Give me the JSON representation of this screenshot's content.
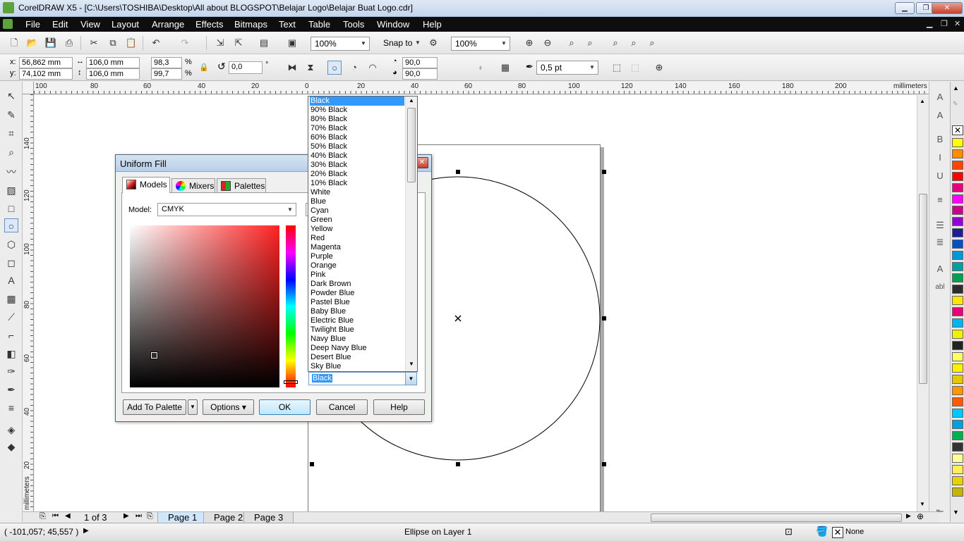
{
  "window": {
    "title": "CorelDRAW X5 - [C:\\Users\\TOSHIBA\\Desktop\\All about BLOGSPOT\\Belajar Logo\\Belajar Buat Logo.cdr]"
  },
  "menu": [
    "File",
    "Edit",
    "View",
    "Layout",
    "Arrange",
    "Effects",
    "Bitmaps",
    "Text",
    "Table",
    "Tools",
    "Window",
    "Help"
  ],
  "toolbar": {
    "zoom1": "100%",
    "snap_to": "Snap to",
    "zoom2": "100%"
  },
  "property_bar": {
    "x_label": "x:",
    "x_value": "56,862 mm",
    "y_label": "y:",
    "y_value": "74,102 mm",
    "width": "106,0 mm",
    "height": "106,0 mm",
    "scale_w": "98,3",
    "scale_h": "99,7",
    "percent": "%",
    "rotation": "0,0",
    "degree": "°",
    "start_angle": "90,0",
    "end_angle": "90,0",
    "outline_width": "0,5 pt"
  },
  "ruler": {
    "unit": "millimeters",
    "h_ticks": [
      "100",
      "80",
      "60",
      "40",
      "20",
      "0",
      "20",
      "40",
      "60",
      "80",
      "100",
      "120",
      "140",
      "160",
      "180",
      "200"
    ],
    "v_ticks": [
      "140",
      "120",
      "100",
      "80",
      "60",
      "40",
      "20"
    ],
    "v_unit": "millimeters"
  },
  "dialog": {
    "title": "Uniform Fill",
    "tabs": [
      "Models",
      "Mixers",
      "Palettes"
    ],
    "model_label": "Model:",
    "model_value": "CMYK",
    "buttons": {
      "add_to_palette": "Add To Palette",
      "options": "Options",
      "ok": "OK",
      "cancel": "Cancel",
      "help": "Help"
    }
  },
  "color_list": {
    "items": [
      "Black",
      "90% Black",
      "80% Black",
      "70% Black",
      "60% Black",
      "50% Black",
      "40% Black",
      "30% Black",
      "20% Black",
      "10% Black",
      "White",
      "Blue",
      "Cyan",
      "Green",
      "Yellow",
      "Red",
      "Magenta",
      "Purple",
      "Orange",
      "Pink",
      "Dark Brown",
      "Powder Blue",
      "Pastel Blue",
      "Baby Blue",
      "Electric Blue",
      "Twilight Blue",
      "Navy Blue",
      "Deep Navy Blue",
      "Desert Blue",
      "Sky Blue"
    ],
    "selected": "Black",
    "combo_value": "Black"
  },
  "pages": {
    "counter": "1 of 3",
    "tabs": [
      "Page 1",
      "Page 2",
      "Page 3"
    ],
    "active": "Page 1"
  },
  "status": {
    "coords": "( -101,057; 45,557 )",
    "object_info": "Ellipse on Layer 1",
    "fill_none": "None"
  },
  "palette_colors": [
    "#ffff00",
    "#ff8c00",
    "#ff4500",
    "#ff0000",
    "#e4007f",
    "#ff00ff",
    "#c8008c",
    "#9400d3",
    "#1e1e96",
    "#0050c8",
    "#0096dc",
    "#00a0a0",
    "#00a050",
    "#2d2d2d",
    "#ffe600",
    "#e60073",
    "#00b4f0",
    "#f0f000",
    "#222222",
    "#ffff66",
    "#fff000",
    "#e6c800",
    "#ff9600",
    "#ff5a00",
    "#00c8ff",
    "#00a0e0",
    "#00b050",
    "#333333",
    "#ffff99",
    "#ffee55",
    "#e6d200",
    "#c8b400"
  ]
}
